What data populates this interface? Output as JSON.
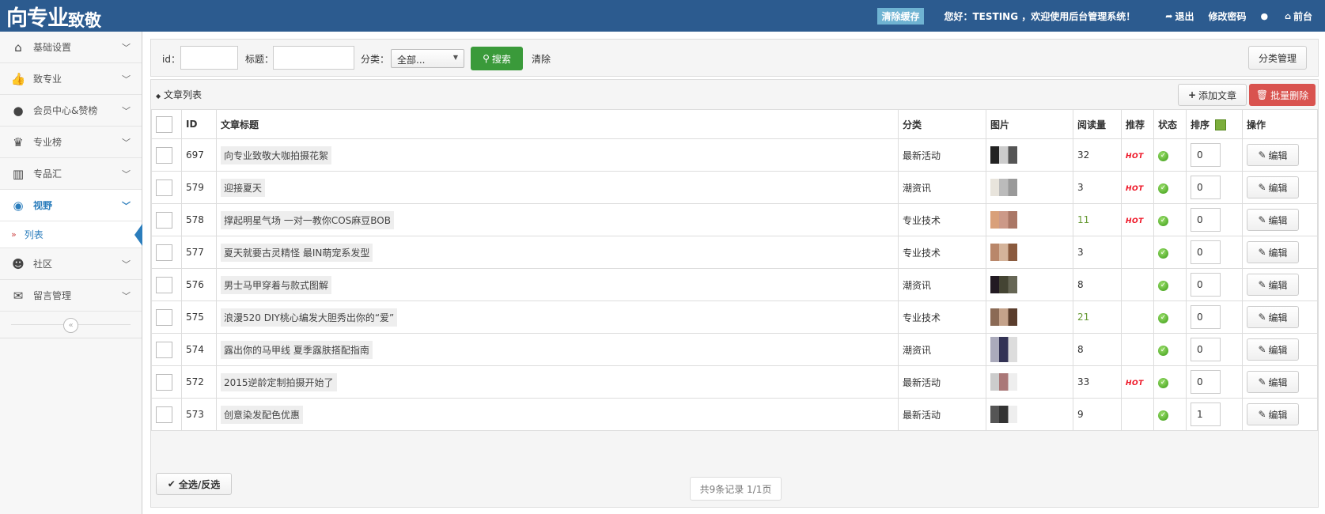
{
  "header": {
    "logo_main": "向专业",
    "logo_sub": "致敬",
    "clear_cache": "清除缓存",
    "greeting": "您好：TESTING ，欢迎使用后台管理系统！",
    "logout": "退出",
    "change_password": "修改密码",
    "frontend": "前台"
  },
  "sidebar": {
    "items": [
      {
        "label": "基础设置",
        "icon": "home-icon"
      },
      {
        "label": "致专业",
        "icon": "thumbs-up-icon"
      },
      {
        "label": "会员中心&赞榜",
        "icon": "user-icon"
      },
      {
        "label": "专业榜",
        "icon": "trophy-icon"
      },
      {
        "label": "专品汇",
        "icon": "barcode-icon"
      },
      {
        "label": "视野",
        "icon": "eye-icon"
      },
      {
        "label": "社区",
        "icon": "group-icon"
      },
      {
        "label": "留言管理",
        "icon": "comments-icon"
      }
    ],
    "sub_item": "列表"
  },
  "search": {
    "id_label": "id：",
    "title_label": "标题：",
    "category_label": "分类：",
    "category_value": "全部...",
    "search_button": "搜索",
    "clear_button": "清除",
    "category_manage": "分类管理"
  },
  "list": {
    "title": "文章列表",
    "add_button": "添加文章",
    "batch_delete_button": "批量删除",
    "columns": [
      "ID",
      "文章标题",
      "分类",
      "图片",
      "阅读量",
      "推荐",
      "状态",
      "排序",
      "操作"
    ],
    "hot_label": "HOT",
    "edit_label": "编辑",
    "rows": [
      {
        "id": "697",
        "title": "向专业致敬大咖拍摄花絮",
        "category": "最新活动",
        "views": "32",
        "hot": true,
        "sort": "0"
      },
      {
        "id": "579",
        "title": "迎接夏天",
        "category": "潮资讯",
        "views": "3",
        "hot": true,
        "sort": "0"
      },
      {
        "id": "578",
        "title": "撑起明星气场 一对一教你COS麻豆BOB",
        "category": "专业技术",
        "views": "11",
        "hot": true,
        "sort": "0"
      },
      {
        "id": "577",
        "title": "夏天就要古灵精怪 最IN萌宠系发型",
        "category": "专业技术",
        "views": "3",
        "hot": false,
        "sort": "0"
      },
      {
        "id": "576",
        "title": "男士马甲穿着与款式图解",
        "category": "潮资讯",
        "views": "8",
        "hot": false,
        "sort": "0"
      },
      {
        "id": "575",
        "title": "浪漫520 DIY桃心编发大胆秀出你的“爱”",
        "category": "专业技术",
        "views": "21",
        "hot": false,
        "sort": "0"
      },
      {
        "id": "574",
        "title": "露出你的马甲线 夏季露肤搭配指南",
        "category": "潮资讯",
        "views": "8",
        "hot": false,
        "sort": "0"
      },
      {
        "id": "572",
        "title": "2015逆龄定制拍摄开始了",
        "category": "最新活动",
        "views": "33",
        "hot": true,
        "sort": "0"
      },
      {
        "id": "573",
        "title": "创意染发配色优惠",
        "category": "最新活动",
        "views": "9",
        "hot": false,
        "sort": "1"
      }
    ],
    "select_all": "全选/反选",
    "pagination": "共9条记录 1/1页"
  },
  "colors": {
    "topbar": "#2c5b8f",
    "accent": "#2b7dbc",
    "search_button": "#3a9a3a",
    "delete_button": "#d9534f"
  }
}
